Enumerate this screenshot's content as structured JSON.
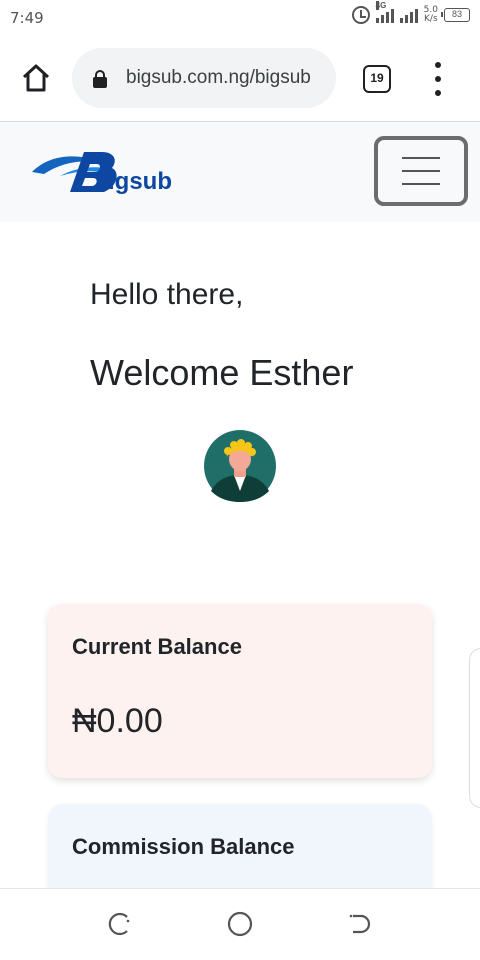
{
  "status_bar": {
    "time": "7:49",
    "network": "4G",
    "speed_value": "5.0",
    "speed_unit": "K/s",
    "battery": "83"
  },
  "browser": {
    "url": "bigsub.com.ng/bigsub",
    "tab_count": "19"
  },
  "site": {
    "logo_text": "igsub",
    "brand_color": "#0d47a1"
  },
  "main": {
    "greeting": "Hello there,",
    "welcome": "Welcome Esther",
    "balance_card": {
      "label": "Current Balance",
      "value": "₦0.00",
      "background": "#fdf2ef"
    },
    "commission_card": {
      "label": "Commission Balance",
      "background": "#f1f5fc"
    }
  },
  "icons": {
    "home": "home-icon",
    "lock": "lock-icon",
    "menu": "more-vert-icon",
    "hamburger": "hamburger-menu-icon",
    "avatar": "user-avatar-icon",
    "nav_back": "back-icon",
    "nav_home": "home-circle-icon",
    "nav_recent": "recent-apps-icon"
  }
}
